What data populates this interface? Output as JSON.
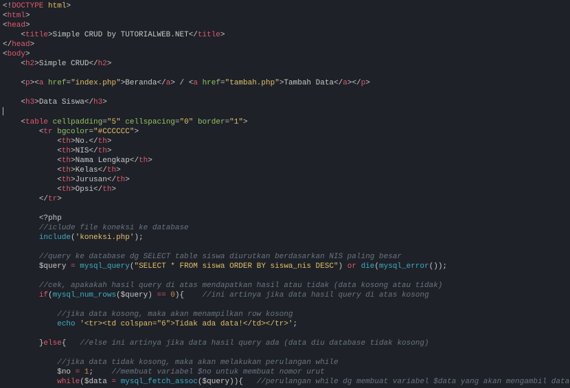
{
  "line1": {
    "a": "<!",
    "b": "DOCTYPE",
    "c": " html",
    "d": ">"
  },
  "line2": {
    "a": "<",
    "b": "html",
    "c": ">"
  },
  "line3": {
    "a": "<",
    "b": "head",
    "c": ">"
  },
  "line4": {
    "pad": "    ",
    "a": "<",
    "b": "title",
    "c": ">",
    "txt": "Simple CRUD by TUTORIALWEB.NET",
    "d": "</",
    "e": "title",
    "f": ">"
  },
  "line5": {
    "a": "</",
    "b": "head",
    "c": ">"
  },
  "line6": {
    "a": "<",
    "b": "body",
    "c": ">"
  },
  "line7": {
    "pad": "    ",
    "a": "<",
    "b": "h2",
    "c": ">",
    "txt": "Simple CRUD",
    "d": "</",
    "e": "h2",
    "f": ">"
  },
  "line8": {
    "pad": "    ",
    "a": "<",
    "b": "p",
    "c": "><",
    "d": "a",
    "sp": " ",
    "attr": "href",
    "eq": "=",
    "val": "\"index.php\"",
    "e": ">",
    "txt1": "Beranda",
    "f": "</",
    "g": "a",
    "h": ">",
    "slash": " / ",
    "i": "<",
    "j": "a",
    "sp2": " ",
    "attr2": "href",
    "eq2": "=",
    "val2": "\"tambah.php\"",
    "k": ">",
    "txt2": "Tambah Data",
    "l": "</",
    "m": "a",
    "n": "></",
    "o": "p",
    "p": ">"
  },
  "line9": {
    "pad": "    ",
    "a": "<",
    "b": "h3",
    "c": ">",
    "txt": "Data Siswa",
    "d": "</",
    "e": "h3",
    "f": ">"
  },
  "line10": {
    "pad": "    ",
    "a": "<",
    "b": "table",
    "sp": " ",
    "a1": "cellpadding",
    "eq1": "=",
    "v1": "\"5\"",
    "sp2": " ",
    "a2": "cellspacing",
    "eq2": "=",
    "v2": "\"0\"",
    "sp3": " ",
    "a3": "border",
    "eq3": "=",
    "v3": "\"1\"",
    "c": ">"
  },
  "line11": {
    "pad": "        ",
    "a": "<",
    "b": "tr",
    "sp": " ",
    "attr": "bgcolor",
    "eq": "=",
    "val": "\"#CCCCCC\"",
    "c": ">"
  },
  "th1": {
    "pad": "            ",
    "a": "<",
    "b": "th",
    "c": ">",
    "txt": "No.",
    "d": "</",
    "e": "th",
    "f": ">"
  },
  "th2": {
    "pad": "            ",
    "a": "<",
    "b": "th",
    "c": ">",
    "txt": "NIS",
    "d": "</",
    "e": "th",
    "f": ">"
  },
  "th3": {
    "pad": "            ",
    "a": "<",
    "b": "th",
    "c": ">",
    "txt": "Nama Lengkap",
    "d": "</",
    "e": "th",
    "f": ">"
  },
  "th4": {
    "pad": "            ",
    "a": "<",
    "b": "th",
    "c": ">",
    "txt": "Kelas",
    "d": "</",
    "e": "th",
    "f": ">"
  },
  "th5": {
    "pad": "            ",
    "a": "<",
    "b": "th",
    "c": ">",
    "txt": "Jurusan",
    "d": "</",
    "e": "th",
    "f": ">"
  },
  "th6": {
    "pad": "            ",
    "a": "<",
    "b": "th",
    "c": ">",
    "txt": "Opsi",
    "d": "</",
    "e": "th",
    "f": ">"
  },
  "line12": {
    "pad": "        ",
    "a": "</",
    "b": "tr",
    "c": ">"
  },
  "php1": {
    "pad": "        ",
    "txt": "<?php"
  },
  "php2": {
    "pad": "        ",
    "c": "//iclude file koneksi ke database"
  },
  "php3": {
    "pad": "        ",
    "fn": "include",
    "o": "(",
    "s": "'koneksi.php'",
    "p": ");"
  },
  "php4": {
    "pad": "        ",
    "c": "//query ke database dg SELECT table siswa diurutkan berdasarkan NIS paling besar"
  },
  "php5": {
    "pad": "        ",
    "v": "$query",
    "sp": " ",
    "eq": "=",
    "sp2": " ",
    "fn": "mysql_query",
    "o": "(",
    "s": "\"SELECT * FROM siswa ORDER BY siswa_nis DESC\"",
    "p": ")",
    "sp3": " ",
    "kw": "or",
    "sp4": " ",
    "fn2": "die",
    "o2": "(",
    "fn3": "mysql_error",
    "o3": "()",
    ")": ");"
  },
  "php6": {
    "pad": "        ",
    "c": "//cek, apakakah hasil query di atas mendapatkan hasil atau tidak (data kosong atau tidak)"
  },
  "php7": {
    "pad": "        ",
    "kw": "if",
    "o": "(",
    "fn": "mysql_num_rows",
    "o2": "(",
    "v": "$query",
    "p": ")",
    "sp": " ",
    "eq": "==",
    "sp2": " ",
    "n": "0",
    "p2": "){",
    "c": "    //ini artinya jika data hasil query di atas kosong"
  },
  "php8": {
    "pad": "            ",
    "c": "//jika data kosong, maka akan menampilkan row kosong"
  },
  "php9": {
    "pad": "            ",
    "kw": "echo",
    "sp": " ",
    "s": "'<tr><td colspan=\"6\">Tidak ada data!</td></tr>'",
    "p": ";"
  },
  "php10": {
    "pad": "        ",
    "b": "}",
    "kw": "else",
    "b2": "{",
    "c": "   //else ini artinya jika data hasil query ada (data diu database tidak kosong)"
  },
  "php11": {
    "pad": "            ",
    "c": "//jika data tidak kosong, maka akan melakukan perulangan while"
  },
  "php12": {
    "pad": "            ",
    "v": "$no",
    "sp": " ",
    "eq": "=",
    "sp2": " ",
    "n": "1",
    "p": ";",
    "c": "    //membuat variabel $no untuk membuat nomor urut"
  },
  "php13": {
    "pad": "            ",
    "kw": "while",
    "o": "(",
    "v": "$data",
    "sp": " ",
    "eq": "=",
    "sp2": " ",
    "fn": "mysql_fetch_assoc",
    "o2": "(",
    "v2": "$query",
    "p": ")){",
    "c": "   //perulangan while dg membuat variabel $data yang akan mengambil data di database"
  }
}
